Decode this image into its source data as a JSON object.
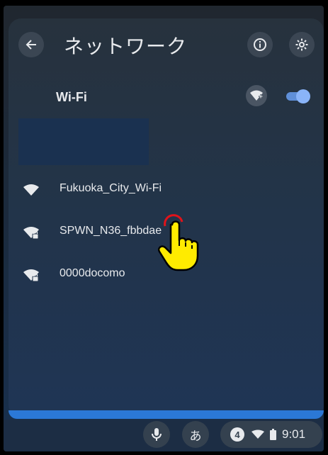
{
  "header": {
    "title": "ネットワーク"
  },
  "wifi": {
    "label": "Wi-Fi",
    "enabled": true
  },
  "networks": [
    {
      "name": "Fukuoka_City_Wi-Fi",
      "secured": false
    },
    {
      "name": "SPWN_N36_fbbdae",
      "secured": true
    },
    {
      "name": "0000docomo",
      "secured": true
    }
  ],
  "shelf": {
    "ime_label": "あ",
    "notification_count": "4",
    "time": "9:01"
  },
  "colors": {
    "accent": "#8ab4f8",
    "text": "#e8eaed",
    "pointer": "#ffeb00"
  }
}
